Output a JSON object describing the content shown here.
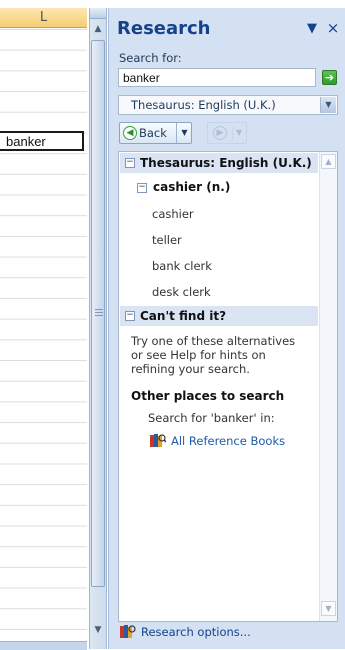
{
  "sheet": {
    "column_label": "L",
    "active_cell_value": "banker"
  },
  "pane": {
    "title": "Research",
    "menu_glyph": "▼",
    "close_glyph": "×",
    "search_label": "Search for:",
    "search_value": "banker",
    "go_glyph": "➔",
    "source_selected": "Thesaurus: English (U.K.)",
    "back_label": "Back",
    "results": {
      "section_title": "Thesaurus: English (U.K.)",
      "headword": "cashier (n.)",
      "synonyms": [
        "cashier",
        "teller",
        "bank clerk",
        "desk clerk"
      ],
      "cant_find_title": "Can't find it?",
      "help_text": "Try one of these alternatives or see Help for hints on refining your search.",
      "other_places_title": "Other places to search",
      "search_for_text": "Search for 'banker' in:",
      "all_books_link": "All Reference Books"
    },
    "footer_link": "Research options..."
  },
  "colors": {
    "pane_bg": "#d4e1f2",
    "title_blue": "#15428b",
    "link_blue": "#1f5aa8",
    "header_bg": "#dae4f3",
    "go_green": "#2e9b2a"
  }
}
